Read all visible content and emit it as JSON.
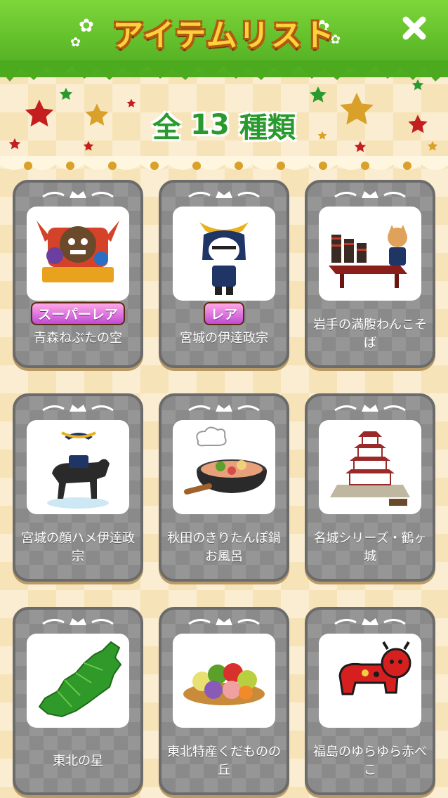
{
  "header": {
    "title": "アイテムリスト",
    "close_icon": "close-icon"
  },
  "summary": {
    "prefix": "全",
    "count": "13",
    "suffix": "種類"
  },
  "items": [
    {
      "name": "青森ねぶたの空",
      "badge": "スーパーレア",
      "icon": "nebuta-float-image"
    },
    {
      "name": "宮城の伊達政宗",
      "badge": "レア",
      "icon": "date-masamune-image"
    },
    {
      "name": "岩手の満腹わんこそば",
      "badge": "",
      "icon": "wanko-soba-image"
    },
    {
      "name": "宮城の顔ハメ伊達政宗",
      "badge": "",
      "icon": "horse-rider-image"
    },
    {
      "name": "秋田のきりたんぽ鍋お風呂",
      "badge": "",
      "icon": "kiritanpo-nabe-image"
    },
    {
      "name": "名城シリーズ・鶴ヶ城",
      "badge": "",
      "icon": "tsurugajo-castle-image"
    },
    {
      "name": "東北の星",
      "badge": "",
      "icon": "tohoku-map-image"
    },
    {
      "name": "東北特産くだものの丘",
      "badge": "",
      "icon": "fruit-basket-image"
    },
    {
      "name": "福島のゆらゆら赤べこ",
      "badge": "",
      "icon": "akabeko-image"
    }
  ],
  "colors": {
    "header_green": "#5cbc28",
    "title_yellow": "#ffd23c",
    "count_green": "#2a9a2f",
    "card_gray": "#8a8a8a"
  }
}
